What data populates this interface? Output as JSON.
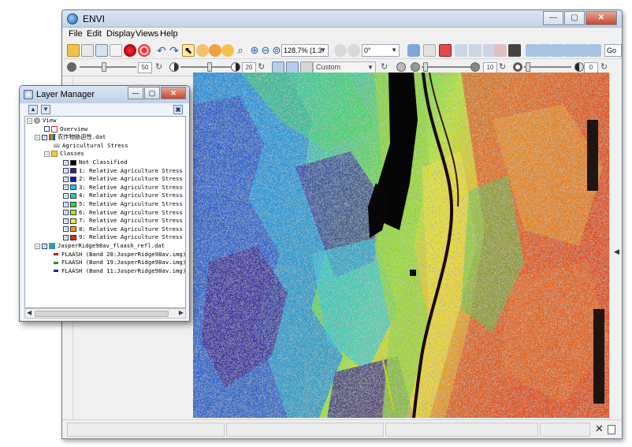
{
  "app": {
    "title": "ENVI",
    "menu": [
      "File",
      "Edit",
      "Display",
      "Views",
      "Help"
    ],
    "zoom_value": "128.7% (1.3:",
    "rotation_value": "0°",
    "go_label": "Go"
  },
  "sliders": {
    "brightness": "50",
    "contrast": "20",
    "stretch_combo": "Custom",
    "sharpen": "10",
    "transparency": "0"
  },
  "layer_manager": {
    "title": "Layer Manager",
    "tree": {
      "view": "View",
      "overview": "Overview",
      "dataset": "农作物胁迫性.dat",
      "dataset_sub": "Agricultural Stress",
      "classes_label": "Classes",
      "not_classified": "Not Classified",
      "classes": [
        {
          "label": "1: Relative Agriculture Stress",
          "color": "#3b1d8c"
        },
        {
          "label": "2: Relative Agriculture Stress",
          "color": "#1018c8"
        },
        {
          "label": "3: Relative Agriculture Stress",
          "color": "#18c8f0"
        },
        {
          "label": "4: Relative Agriculture Stress",
          "color": "#22d8a8"
        },
        {
          "label": "5: Relative Agriculture Stress",
          "color": "#30e030"
        },
        {
          "label": "6: Relative Agriculture Stress",
          "color": "#9cf018"
        },
        {
          "label": "7: Relative Agriculture Stress",
          "color": "#f8f020"
        },
        {
          "label": "8: Relative Agriculture Stress",
          "color": "#f0a010"
        },
        {
          "label": "9: Relative Agriculture Stress",
          "color": "#e02a10"
        }
      ],
      "raster": "JasperRidge98av_flaash_refl.dat",
      "bands": [
        {
          "label": "FLAASH (Band 28:JasperRidge98av.img)",
          "color": "#d01010"
        },
        {
          "label": "FLAASH (Band 19:JasperRidge98av.img)",
          "color": "#10a020"
        },
        {
          "label": "FLAASH (Band 11:JasperRidge98av.img)",
          "color": "#1020c0"
        }
      ]
    }
  }
}
